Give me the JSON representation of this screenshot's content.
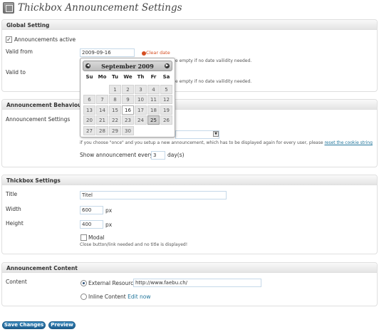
{
  "header": {
    "title": "Thickbox Announcement Settings",
    "icon": "settings-page-icon"
  },
  "global": {
    "heading": "Global Setting",
    "announcements_active_label": "Announcements active",
    "announcements_active_checked": true,
    "valid_from_label": "Valid from",
    "valid_from_value": "2009-09-16",
    "clear_date_label": "Clear date",
    "valid_from_hint": "e empty if no date vailidity needed.",
    "valid_to_label": "Valid to",
    "valid_to_hint": "e empty if no date vailidity needed."
  },
  "calendar": {
    "title": "September 2009",
    "prev_icon": "prev-month-icon",
    "next_icon": "next-month-icon",
    "weekdays": [
      "Su",
      "Mo",
      "Tu",
      "We",
      "Th",
      "Fr",
      "Sa"
    ],
    "weeks": [
      [
        "",
        "",
        "1",
        "2",
        "3",
        "4",
        "5"
      ],
      [
        "6",
        "7",
        "8",
        "9",
        "10",
        "11",
        "12"
      ],
      [
        "13",
        "14",
        "15",
        "16",
        "17",
        "18",
        "19"
      ],
      [
        "20",
        "21",
        "22",
        "23",
        "24",
        "25",
        "26"
      ],
      [
        "27",
        "28",
        "29",
        "30",
        "",
        "",
        ""
      ]
    ],
    "today": "16",
    "selected": "25"
  },
  "behaviour": {
    "heading": "Announcement Behaviour",
    "settings_label": "Announcement Settings",
    "once_hint_prefix": "if you choose \"once\" and you setup a new announcement, which has to be displayed again for every user, please",
    "reset_cookie_link": "reset the cookie string",
    "show_every_label": "Show announcement every",
    "show_every_value": "3",
    "show_every_unit": "day(s)"
  },
  "thickbox": {
    "heading": "Thickbox Settings",
    "title_label": "Title",
    "title_value": "Titel",
    "width_label": "Width",
    "width_value": "600",
    "width_unit": "px",
    "height_label": "Height",
    "height_value": "400",
    "height_unit": "px",
    "modal_label": "Modal",
    "modal_checked": false,
    "modal_hint": "Close button/link needed and no title is displayed!"
  },
  "content": {
    "heading": "Announcement Content",
    "content_label": "Content",
    "external_label": "External Resource",
    "external_selected": true,
    "external_value": "http://www.faebu.ch/",
    "inline_label": "Inline Content",
    "edit_now_label": "Edit now"
  },
  "actions": {
    "save_label": "Save Changes",
    "preview_label": "Preview"
  }
}
